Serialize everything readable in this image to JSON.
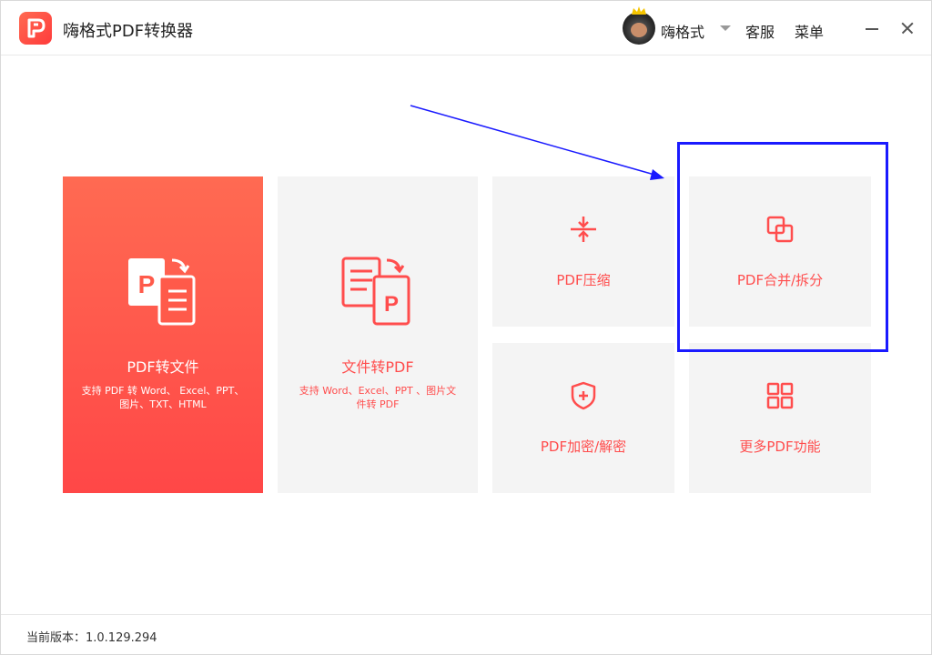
{
  "app": {
    "title": "嗨格式PDF转换器",
    "accent_color": "#ff4d4d",
    "icon": "pdf-logo-icon"
  },
  "header": {
    "username": "嗨格式",
    "service_label": "客服",
    "menu_label": "菜单",
    "avatar_icon": "avatar-icon"
  },
  "cards": {
    "pdf_to_file": {
      "title": "PDF转文件",
      "desc": "支持 PDF 转 Word、 Excel、PPT、图片、TXT、HTML",
      "icon": "pdf-to-file-icon"
    },
    "file_to_pdf": {
      "title": "文件转PDF",
      "desc": "支持 Word、Excel、PPT 、图片文件转 PDF",
      "icon": "file-to-pdf-icon"
    },
    "compress": {
      "title": "PDF压缩",
      "icon": "compress-icon"
    },
    "merge_split": {
      "title": "PDF合并/拆分",
      "icon": "merge-icon"
    },
    "encrypt": {
      "title": "PDF加密/解密",
      "icon": "shield-icon"
    },
    "more": {
      "title": "更多PDF功能",
      "icon": "grid-icon"
    }
  },
  "annotation": {
    "highlight_color": "#1a1aff"
  },
  "footer": {
    "version_text": "当前版本：1.0.129.294"
  }
}
